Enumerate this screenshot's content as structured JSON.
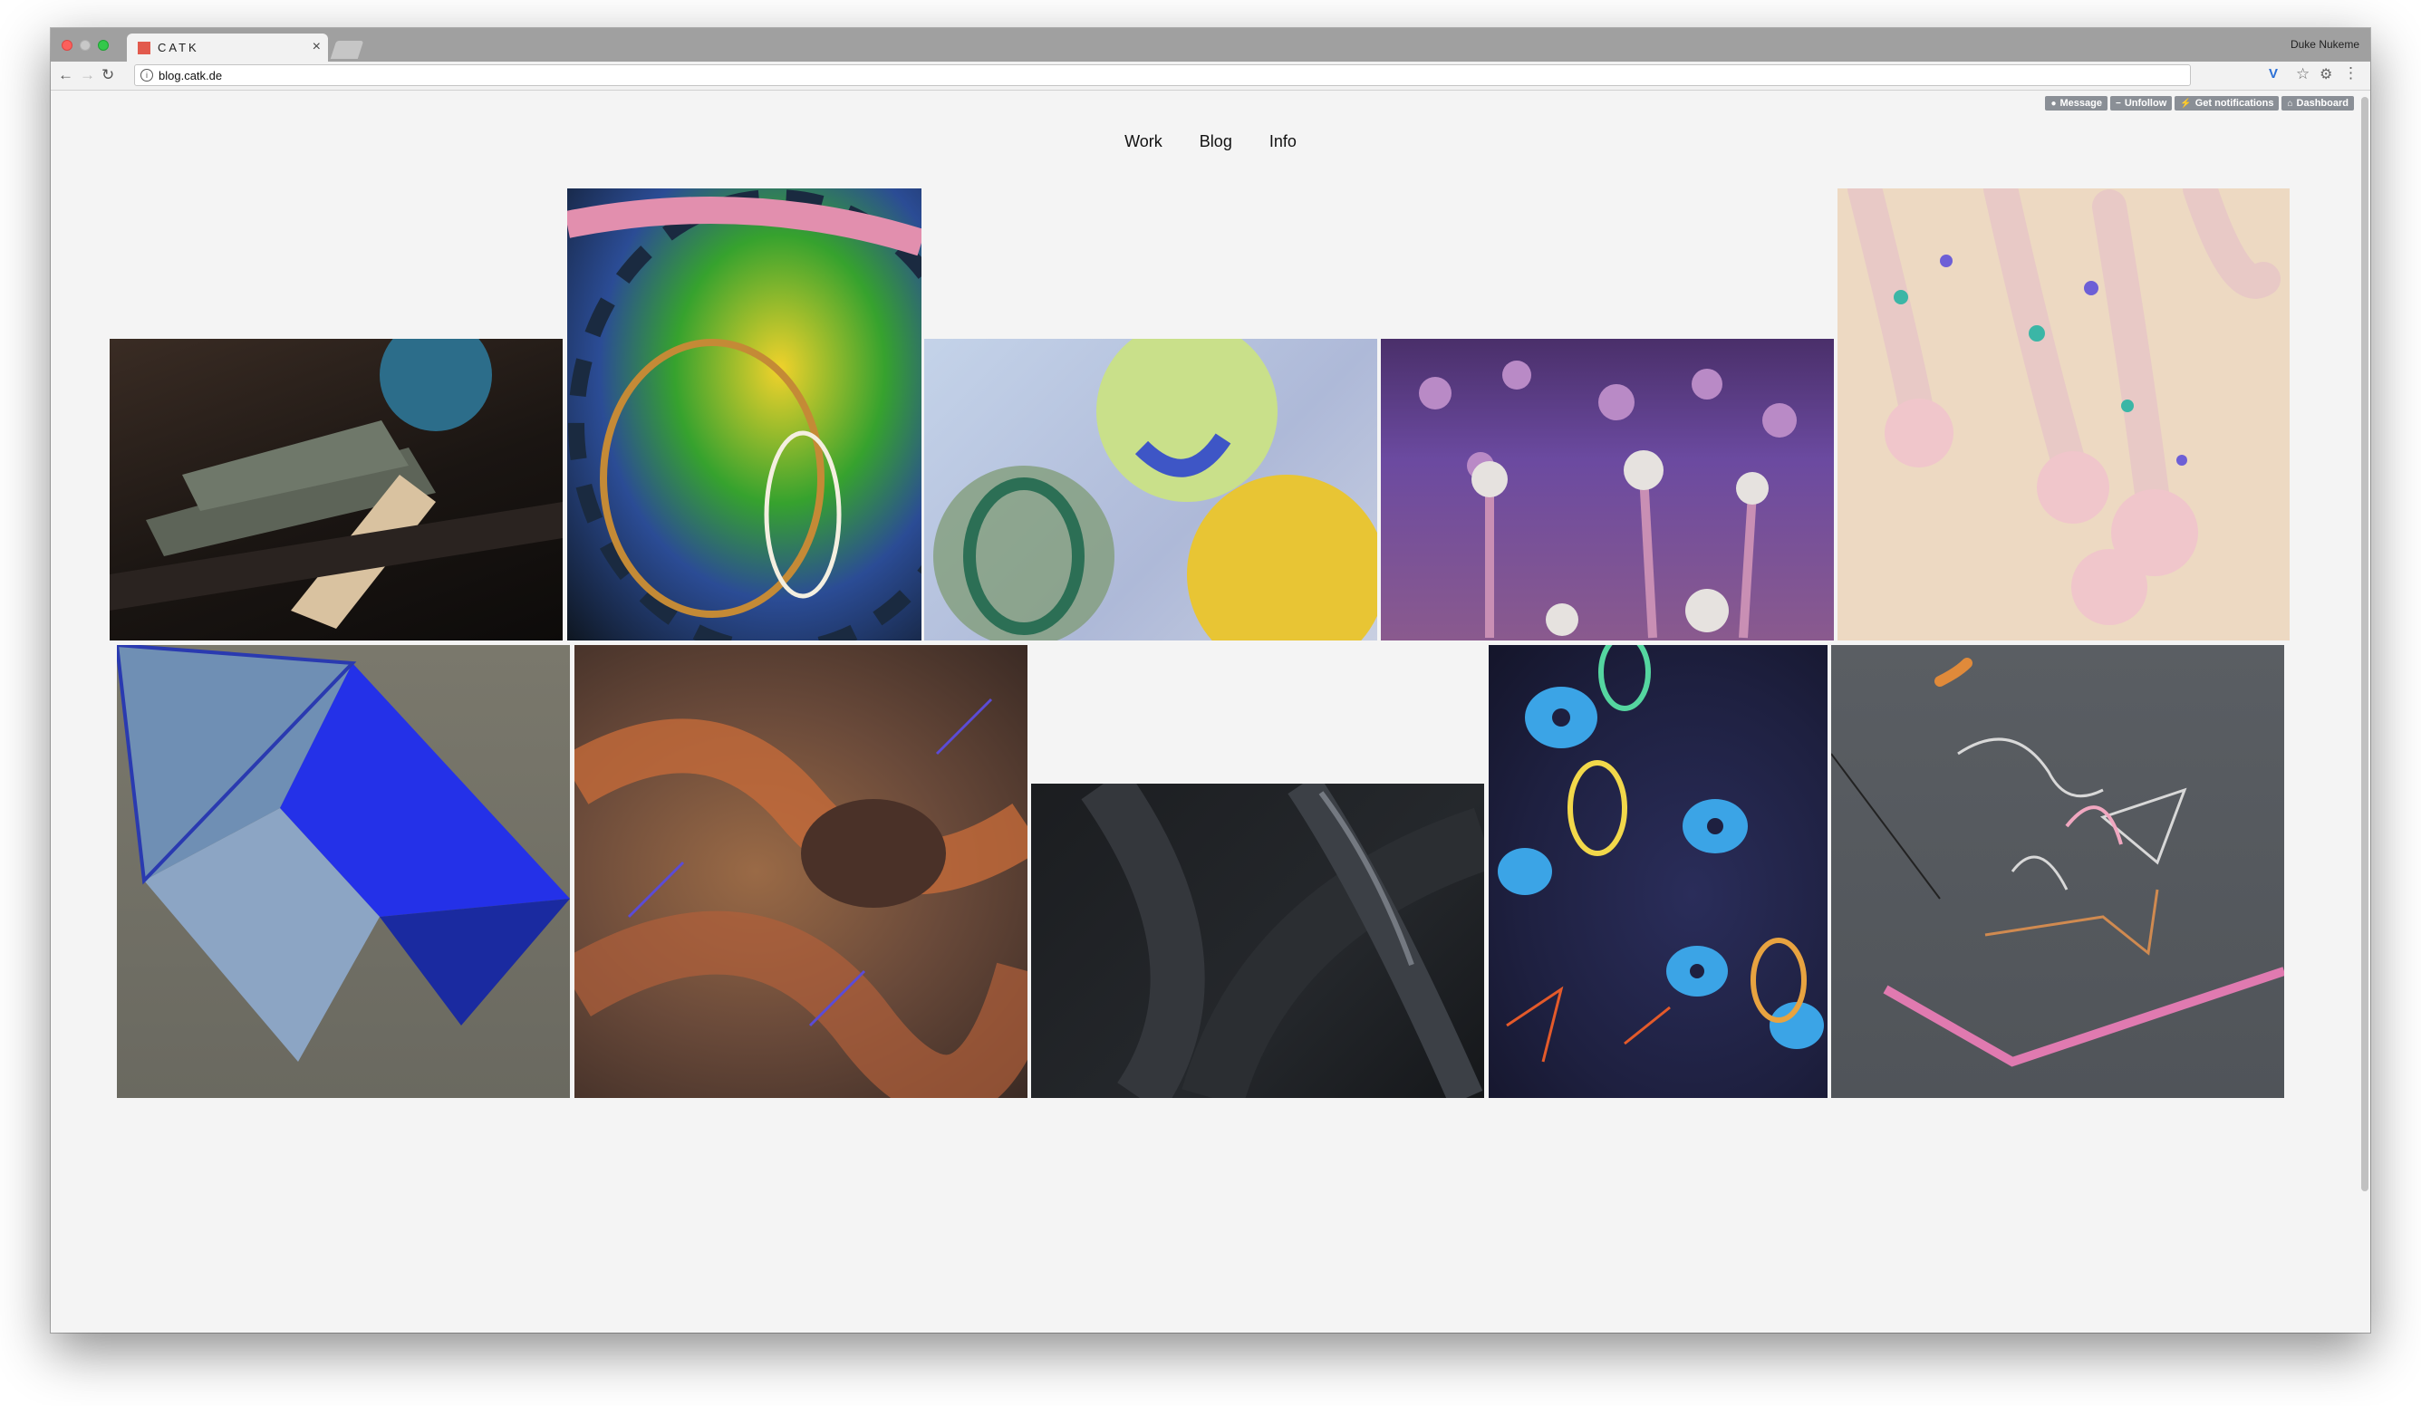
{
  "browser": {
    "tab_title": "CATK",
    "tab_close": "×",
    "profile_name": "Duke Nukeme",
    "url": "blog.catk.de",
    "nav_back": "←",
    "nav_forward": "→",
    "nav_reload": "↻",
    "extension_v": "V",
    "bookmark_star": "☆",
    "extension_gear": "⚙",
    "menu_dots": "⋮"
  },
  "tumblr_controls": [
    {
      "icon": "message-icon",
      "glyph": "●",
      "label": "Message"
    },
    {
      "icon": "unfollow-icon",
      "glyph": "−",
      "label": "Unfollow"
    },
    {
      "icon": "lightning-icon",
      "glyph": "⚡",
      "label": "Get notifications"
    },
    {
      "icon": "home-icon",
      "glyph": "⌂",
      "label": "Dashboard"
    }
  ],
  "site_nav": [
    "Work",
    "Blog",
    "Info"
  ],
  "gallery": {
    "row1": [
      "Dark fan sculpture with blue sphere",
      "Colorful patterned sphere",
      "Soft blurred spheres",
      "Purple mushroom forest",
      "Pastel dripping spheres"
    ],
    "row2": [
      "Blue origami polyhedron",
      "Orange speckled organic surface",
      "Black woven ribbons",
      "Colorful rings and discs",
      "Grey line sculptures"
    ]
  },
  "colors": {
    "page_bg": "#f4f4f4",
    "tab_strip": "#a0a0a0",
    "control_button": "#8a8f96"
  }
}
